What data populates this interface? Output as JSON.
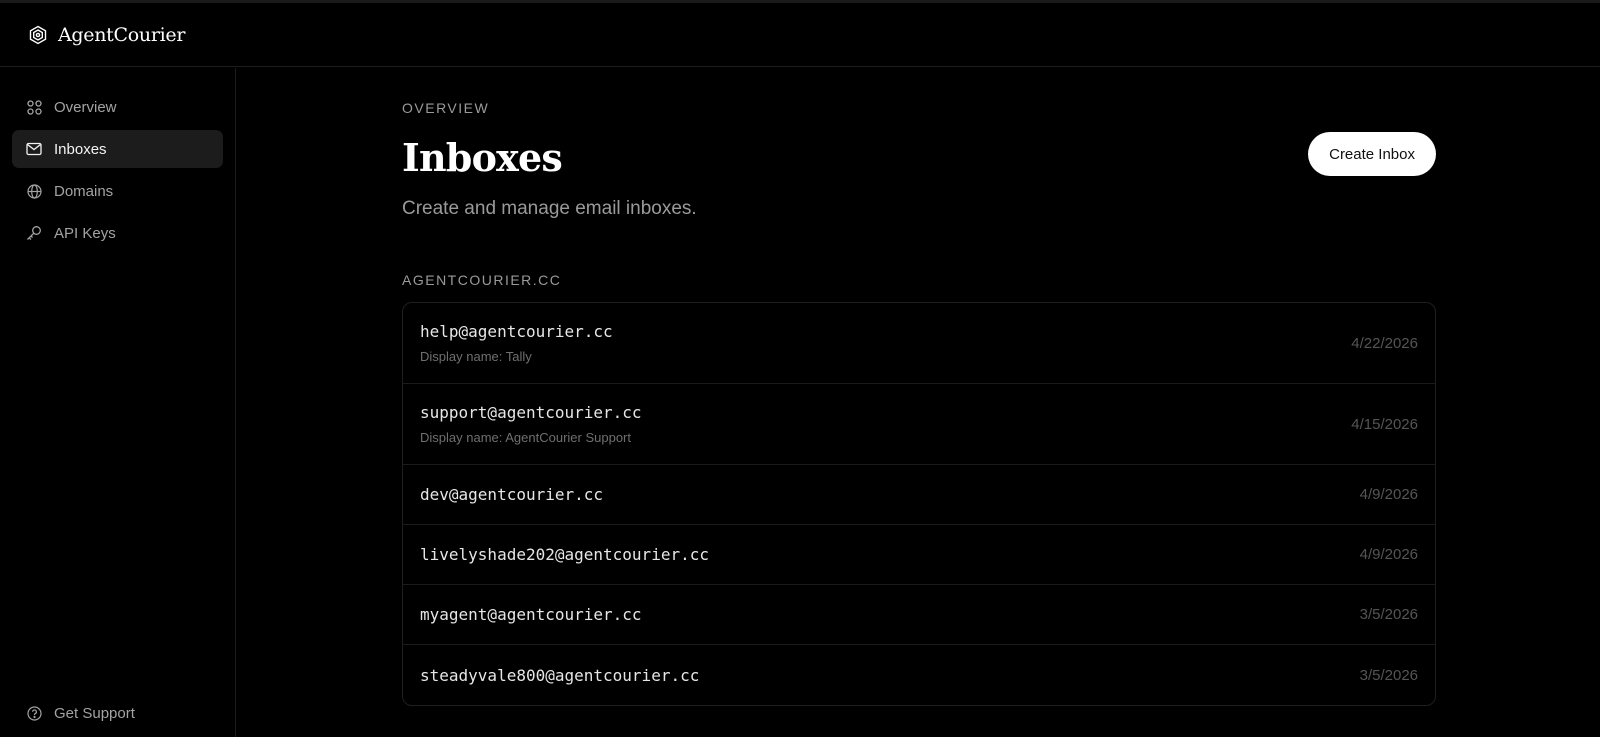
{
  "brand": {
    "name": "AgentCourier"
  },
  "sidebar": {
    "items": [
      {
        "label": "Overview",
        "icon": "grid-icon",
        "active": false
      },
      {
        "label": "Inboxes",
        "icon": "mail-icon",
        "active": true
      },
      {
        "label": "Domains",
        "icon": "globe-icon",
        "active": false
      },
      {
        "label": "API Keys",
        "icon": "key-icon",
        "active": false
      }
    ],
    "support_label": "Get Support"
  },
  "main": {
    "eyebrow": "OVERVIEW",
    "title": "Inboxes",
    "subtitle": "Create and manage email inboxes.",
    "create_label": "Create Inbox",
    "section_label": "AGENTCOURIER.CC",
    "inboxes": [
      {
        "address": "help@agentcourier.cc",
        "display_name": "Display name: Tally",
        "date": "4/22/2026"
      },
      {
        "address": "support@agentcourier.cc",
        "display_name": "Display name: AgentCourier Support",
        "date": "4/15/2026"
      },
      {
        "address": "dev@agentcourier.cc",
        "display_name": "",
        "date": "4/9/2026"
      },
      {
        "address": "livelyshade202@agentcourier.cc",
        "display_name": "",
        "date": "4/9/2026"
      },
      {
        "address": "myagent@agentcourier.cc",
        "display_name": "",
        "date": "3/5/2026"
      },
      {
        "address": "steadyvale800@agentcourier.cc",
        "display_name": "",
        "date": "3/5/2026"
      }
    ]
  },
  "colors": {
    "background": "#000000",
    "active_nav": "#1c1c1c",
    "button_bg": "#ffffff",
    "muted_text": "#9a9a9a"
  }
}
